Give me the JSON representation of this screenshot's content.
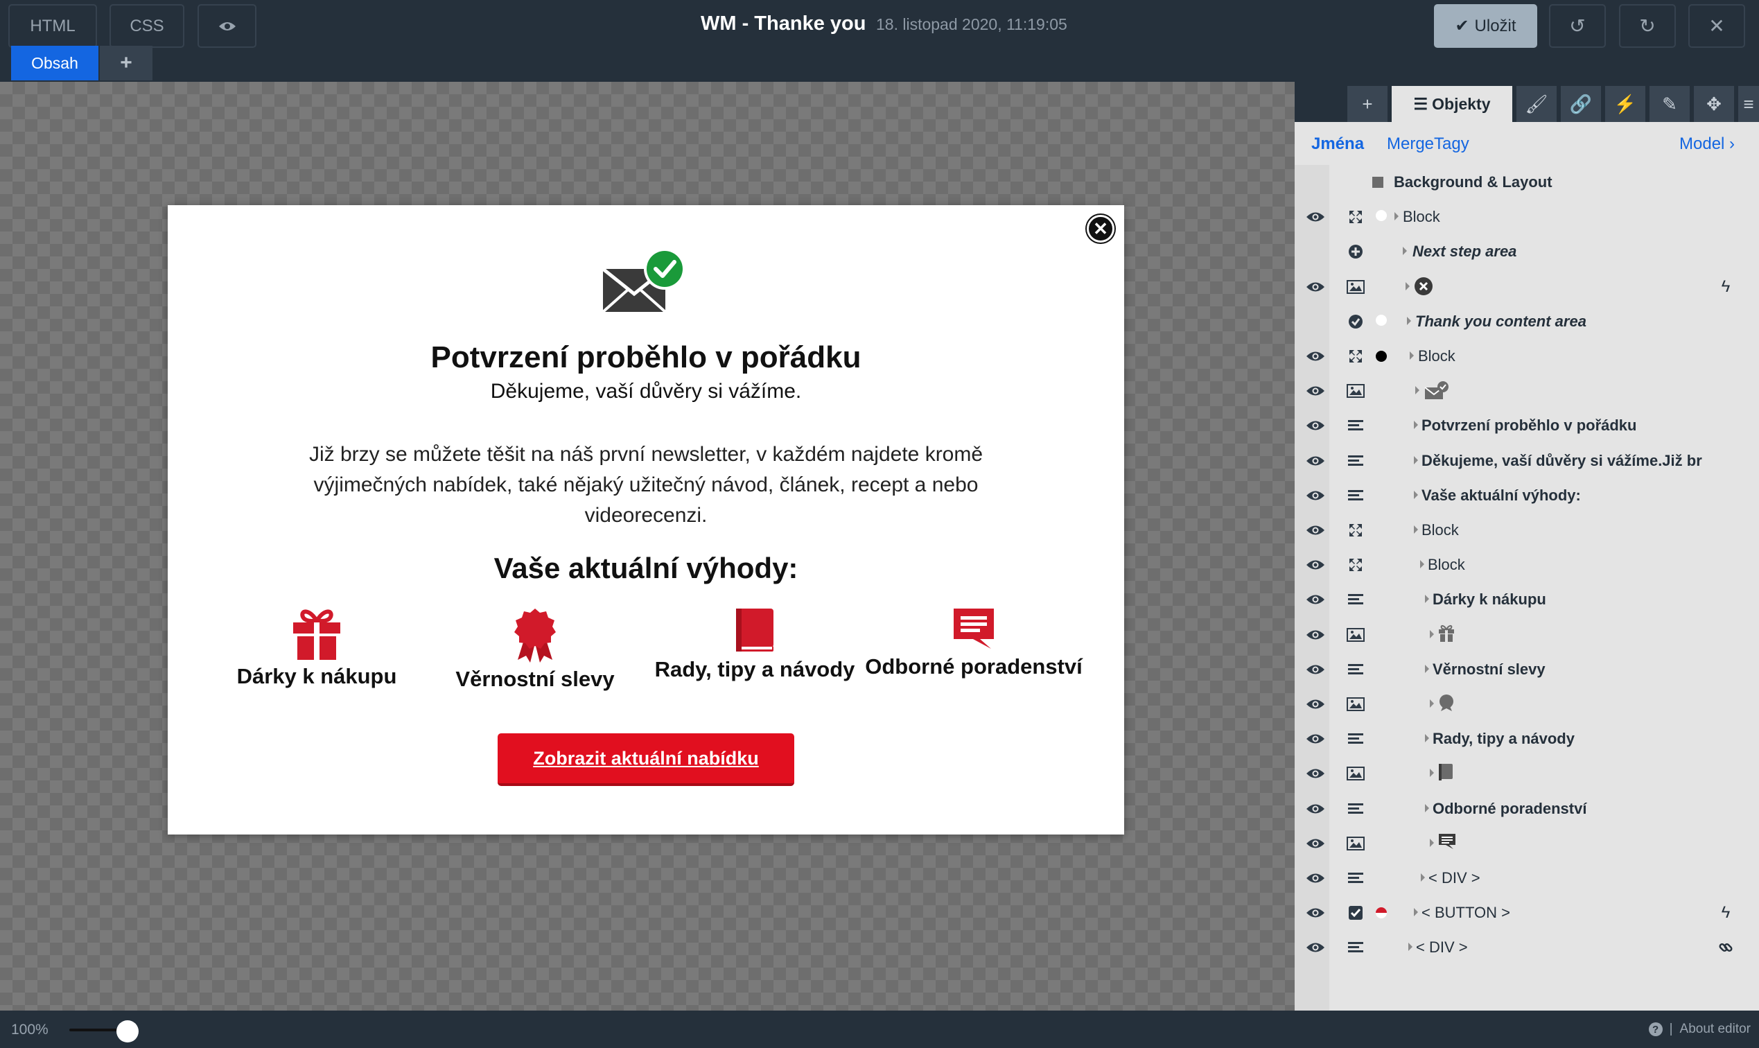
{
  "topbar": {
    "html_tab": "HTML",
    "css_tab": "CSS",
    "title": "WM - Thanke you",
    "date": "18. listopad 2020, 11:19:05",
    "save_label": "Uložit",
    "content_tab": "Obsah",
    "add_tab": "+"
  },
  "popup": {
    "heading": "Potvrzení proběhlo v pořádku",
    "subheading": "Děkujeme, vaší důvěry si vážíme.",
    "paragraph": "Již brzy se můžete těšit na náš první newsletter, v každém najdete kromě výjimečných nabídek, také nějaký užitečný návod, článek, recept a nebo videorecenzi.",
    "benefits_heading": "Vaše aktuální výhody:",
    "benefits": [
      {
        "label": "Dárky k nákupu",
        "icon": "gift-icon"
      },
      {
        "label": "Věrnostní slevy",
        "icon": "rosette-icon"
      },
      {
        "label": "Rady, tipy a návody",
        "icon": "book-icon"
      },
      {
        "label": "Odborné poradenství",
        "icon": "chat-icon"
      }
    ],
    "cta": "Zobrazit aktuální nabídku",
    "accent": "#e10f1f"
  },
  "panel": {
    "active_tab": "Objekty",
    "subnav": {
      "names": "Jména",
      "mergetags": "MergeTagy",
      "model": "Model ›"
    },
    "rows": [
      {
        "name": "Background & Layout",
        "style": "b"
      },
      {
        "name": "Block",
        "style": ""
      },
      {
        "name": "Next step area",
        "style": "i"
      },
      {
        "name": "",
        "style": ""
      },
      {
        "name": "Thank you content area",
        "style": "i"
      },
      {
        "name": "Block",
        "style": ""
      },
      {
        "name": "",
        "style": ""
      },
      {
        "name": "Potvrzení proběhlo v pořádku",
        "style": "b"
      },
      {
        "name": "Děkujeme, vaší důvěry si vážíme.Již br",
        "style": "b"
      },
      {
        "name": "Vaše aktuální výhody:",
        "style": "b"
      },
      {
        "name": "Block",
        "style": ""
      },
      {
        "name": "Block",
        "style": ""
      },
      {
        "name": "Dárky k nákupu",
        "style": "b"
      },
      {
        "name": "",
        "style": ""
      },
      {
        "name": "Věrnostní slevy",
        "style": "b"
      },
      {
        "name": "",
        "style": ""
      },
      {
        "name": "Rady, tipy a návody",
        "style": "b"
      },
      {
        "name": "",
        "style": ""
      },
      {
        "name": "Odborné poradenství",
        "style": "b"
      },
      {
        "name": "",
        "style": ""
      },
      {
        "name": "< DIV >",
        "style": ""
      },
      {
        "name": "< BUTTON >",
        "style": ""
      },
      {
        "name": "< DIV >",
        "style": ""
      }
    ]
  },
  "bottom": {
    "zoom": "100%",
    "about": "About editor"
  }
}
